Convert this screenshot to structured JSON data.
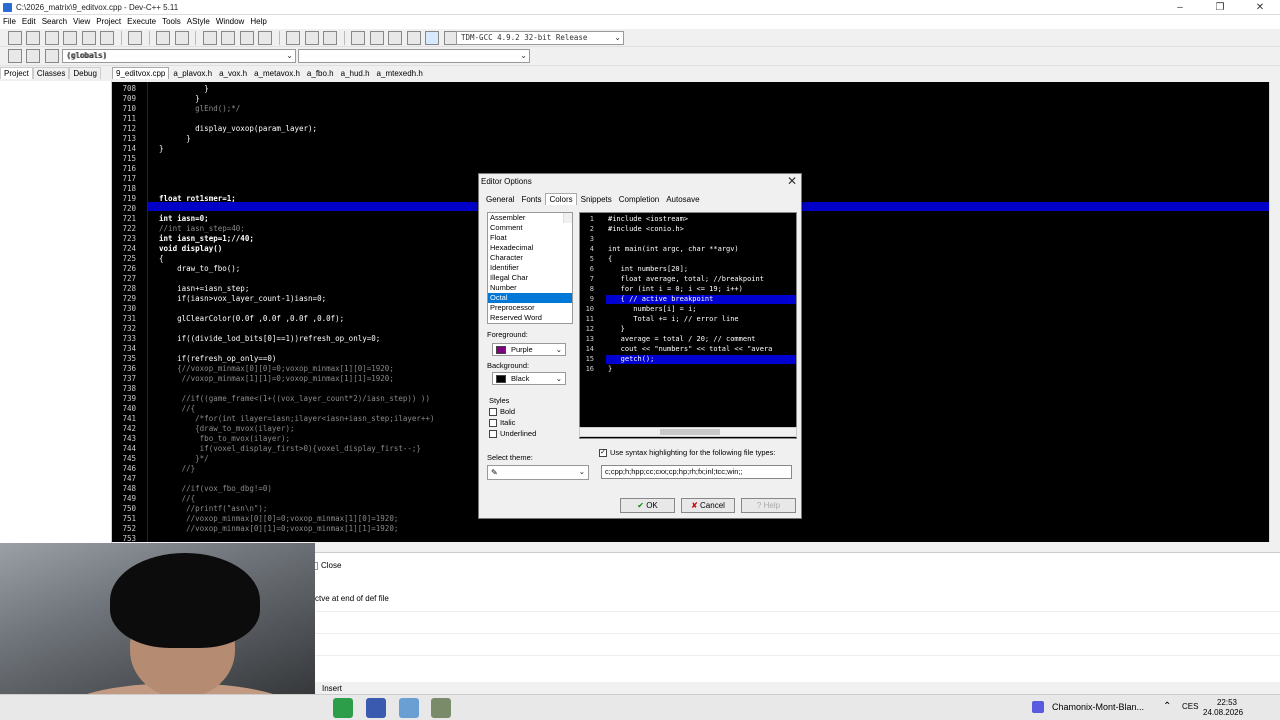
{
  "window": {
    "title": "C:\\2026_matrix\\9_editvox.cpp - Dev-C++ 5.11"
  },
  "menu": [
    "File",
    "Edit",
    "Search",
    "View",
    "Project",
    "Execute",
    "Tools",
    "AStyle",
    "Window",
    "Help"
  ],
  "compiler_combo": "TDM-GCC 4.9.2 32-bit Release",
  "scope_combo": "(globals)",
  "left_tabs": [
    "Project",
    "Classes",
    "Debug"
  ],
  "file_tabs": [
    "9_editvox.cpp",
    "a_plavox.h",
    "a_vox.h",
    "a_metavox.h",
    "a_fbo.h",
    "a_hud.h",
    "a_mtexedh.h"
  ],
  "editor_lines": [
    {
      "n": "708",
      "t": "            }"
    },
    {
      "n": "709",
      "t": "          }"
    },
    {
      "n": "710",
      "t": "          glEnd();*/"
    },
    {
      "n": "711",
      "t": ""
    },
    {
      "n": "712",
      "t": "          display_voxop(param_layer);"
    },
    {
      "n": "713",
      "t": "        }"
    },
    {
      "n": "714",
      "t": "  }"
    },
    {
      "n": "715",
      "t": ""
    },
    {
      "n": "716",
      "t": ""
    },
    {
      "n": "717",
      "t": ""
    },
    {
      "n": "718",
      "t": ""
    },
    {
      "n": "719",
      "t": "  float rot1smer=1;"
    },
    {
      "n": "720",
      "t": ""
    },
    {
      "n": "721",
      "t": "  int iasn=0;"
    },
    {
      "n": "722",
      "t": "  //int iasn_step=40;"
    },
    {
      "n": "723",
      "t": "  int iasn_step=1;//40;"
    },
    {
      "n": "724",
      "t": "  void display()"
    },
    {
      "n": "725",
      "t": "  {"
    },
    {
      "n": "726",
      "t": "      draw_to_fbo();"
    },
    {
      "n": "727",
      "t": ""
    },
    {
      "n": "728",
      "t": "      iasn+=iasn_step;"
    },
    {
      "n": "729",
      "t": "      if(iasn>vox_layer_count-1)iasn=0;"
    },
    {
      "n": "730",
      "t": ""
    },
    {
      "n": "731",
      "t": "      glClearColor(0.0f ,0.0f ,0.0f ,0.0f);"
    },
    {
      "n": "732",
      "t": ""
    },
    {
      "n": "733",
      "t": "      if((divide_lod_bits[0]==1))refresh_op_only=0;"
    },
    {
      "n": "734",
      "t": ""
    },
    {
      "n": "735",
      "t": "      if(refresh_op_only==0)"
    },
    {
      "n": "736",
      "t": "      {//voxop_minmax[0][0]=0;voxop_minmax[1][0]=1920;"
    },
    {
      "n": "737",
      "t": "       //voxop_minmax[1][1]=0;voxop_minmax[1][1]=1920;"
    },
    {
      "n": "738",
      "t": ""
    },
    {
      "n": "739",
      "t": "       //if((game_frame<(1+((vox_layer_count*2)/iasn_step)) ))"
    },
    {
      "n": "740",
      "t": "       //{"
    },
    {
      "n": "741",
      "t": "          /*for(int ilayer=iasn;ilayer<iasn+iasn_step;ilayer++)"
    },
    {
      "n": "742",
      "t": "          {draw_to_mvox(ilayer);"
    },
    {
      "n": "743",
      "t": "           fbo_to_mvox(ilayer);"
    },
    {
      "n": "744",
      "t": "           if(voxel_display_first>0){voxel_display_first--;}"
    },
    {
      "n": "745",
      "t": "          }*/"
    },
    {
      "n": "746",
      "t": "       //}"
    },
    {
      "n": "747",
      "t": ""
    },
    {
      "n": "748",
      "t": "       //if(vox_fbo_dbg!=0)"
    },
    {
      "n": "749",
      "t": "       //{"
    },
    {
      "n": "750",
      "t": "        //printf(\"asn\\n\");"
    },
    {
      "n": "751",
      "t": "        //voxop_minmax[0][0]=0;voxop_minmax[1][0]=1920;"
    },
    {
      "n": "752",
      "t": "        //voxop_minmax[0][1]=0;voxop_minmax[1][1]=1920;"
    },
    {
      "n": "753",
      "t": ""
    }
  ],
  "bottom": {
    "close_tab": "Close",
    "message": "ctve at end of def file",
    "status_mode": "Insert"
  },
  "dialog": {
    "title": "Editor Options",
    "tabs": [
      "General",
      "Fonts",
      "Colors",
      "Snippets",
      "Completion",
      "Autosave"
    ],
    "active_tab": "Colors",
    "elements": [
      "Assembler",
      "Comment",
      "Float",
      "Hexadecimal",
      "Character",
      "Identifier",
      "Illegal Char",
      "Number",
      "Octal",
      "Preprocessor",
      "Reserved Word"
    ],
    "selected_element": "Octal",
    "foreground_label": "Foreground:",
    "foreground_value": "Purple",
    "foreground_color": "#800080",
    "background_label": "Background:",
    "background_value": "Black",
    "background_color": "#000000",
    "styles_label": "Styles",
    "styles": [
      "Bold",
      "Italic",
      "Underlined"
    ],
    "select_theme_label": "Select theme:",
    "syntax_label": "Use syntax highlighting for the following file types:",
    "syntax_checked": true,
    "file_types": "c;cpp;h;hpp;cc;cxx;cp;hp;rh;fx;inl;tcc;win;;",
    "ok": "OK",
    "cancel": "Cancel",
    "help": "Help",
    "preview_lines": [
      {
        "n": "1",
        "t": "#include <iostream>"
      },
      {
        "n": "2",
        "t": "#include <conio.h>"
      },
      {
        "n": "3",
        "t": ""
      },
      {
        "n": "4",
        "t": "int main(int argc, char **argv)"
      },
      {
        "n": "5",
        "t": "{"
      },
      {
        "n": "6",
        "t": "   int numbers[20];"
      },
      {
        "n": "7",
        "t": "   float average, total; //breakpoint"
      },
      {
        "n": "8",
        "t": "   for (int i = 0; i <= 19; i++)"
      },
      {
        "n": "9",
        "t": "   { // active breakpoint"
      },
      {
        "n": "10",
        "t": "      numbers[i] = i;"
      },
      {
        "n": "11",
        "t": "      Total += i; // error line"
      },
      {
        "n": "12",
        "t": "   }"
      },
      {
        "n": "13",
        "t": "   average = total / 20; // comment"
      },
      {
        "n": "14",
        "t": "   cout << \"numbers\" << total << \"avera"
      },
      {
        "n": "15",
        "t": "   getch();"
      },
      {
        "n": "16",
        "t": "}"
      }
    ]
  },
  "taskbar": {
    "weather": "Chamonix-Mont-Blan...",
    "lang": "CES",
    "time": "22:53",
    "date": "24.08.2026"
  }
}
